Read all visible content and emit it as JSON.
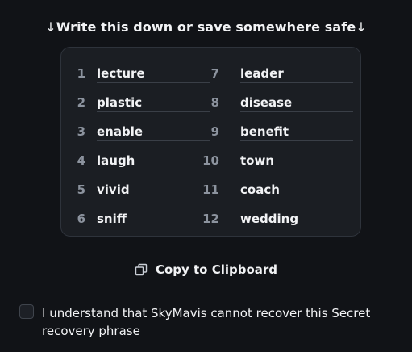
{
  "heading": {
    "arrow_left": "↓",
    "text": "Write this down or save somewhere safe",
    "arrow_right": "↓"
  },
  "words_left": [
    {
      "num": "1",
      "word": "lecture"
    },
    {
      "num": "2",
      "word": "plastic"
    },
    {
      "num": "3",
      "word": "enable"
    },
    {
      "num": "4",
      "word": "laugh"
    },
    {
      "num": "5",
      "word": "vivid"
    },
    {
      "num": "6",
      "word": "sniff"
    }
  ],
  "words_right": [
    {
      "num": "7",
      "word": "leader"
    },
    {
      "num": "8",
      "word": "disease"
    },
    {
      "num": "9",
      "word": "benefit"
    },
    {
      "num": "10",
      "word": "town"
    },
    {
      "num": "11",
      "word": "coach"
    },
    {
      "num": "12",
      "word": "wedding"
    }
  ],
  "copy": {
    "icon": "copy-icon",
    "label": "Copy to Clipboard"
  },
  "consent": {
    "checked": false,
    "text": "I understand that SkyMavis cannot recover this Secret recovery phrase"
  },
  "colors": {
    "background": "#111317",
    "card": "#1b1e23",
    "text": "#f2f3f5",
    "muted": "#8c939e"
  }
}
